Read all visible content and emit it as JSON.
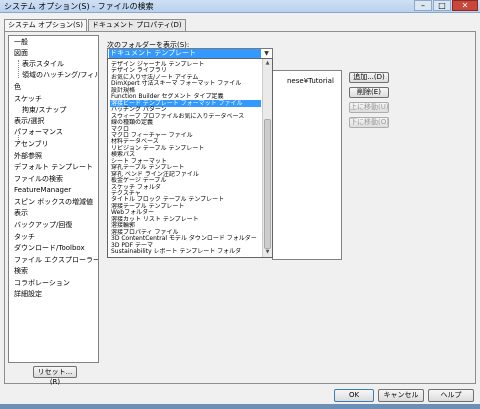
{
  "window": {
    "title": "システム オプション(S) - ファイルの検索"
  },
  "tabs": [
    {
      "label": "システム オプション(S)"
    },
    {
      "label": "ドキュメント プロパティ(D)"
    }
  ],
  "nav": {
    "items": [
      "一般",
      "図面",
      "表示スタイル",
      "領域のハッチング/フィル",
      "色",
      "スケッチ",
      "拘束/スナップ",
      "表示/選択",
      "パフォーマンス",
      "アセンブリ",
      "外部参照",
      "デフォルト テンプレート",
      "ファイルの検索",
      "FeatureManager",
      "スピン ボックスの増減値",
      "表示",
      "バックアップ/回復",
      "タッチ",
      "ダウンロード/Toolbox",
      "ファイル エクスプローラー",
      "検索",
      "コラボレーション",
      "詳細設定"
    ]
  },
  "reset_button": "リセット...(R)",
  "folder_label": "次のフォルダーを表示(S):",
  "combo": {
    "value": "ドキュメント テンプレート"
  },
  "background_list": {
    "text": "nese¥Tutorial"
  },
  "dropdown": {
    "items": [
      "デザイン ジャーナル テンプレート",
      "デザイン ライブラリ",
      "お気に入り寸法/ノート アイテム",
      "DimXpert 寸法スキーマ フォーマット ファイル",
      "設計規格",
      "Function Builder セグメント タイプ定義",
      "溶接ビード テンプレート フォーマット ファイル",
      "ハッチング パターン",
      "スウィープ プロファイルお気に入りデータベース",
      "線の種類の定義",
      "マクロ",
      "マクロ フィーチャー ファイル",
      "材料データベース",
      "リビジョン テーブル テンプレート",
      "検索パス",
      "シート フォーマット",
      "穿孔テーブル テンプレート",
      "穿孔 ベンド ライン注記ファイル",
      "板金ゲージ テーブル",
      "スケッチ フォルダ",
      "テクスチャ",
      "タイトル ブロック テーブル テンプレート",
      "溶接テーブル テンプレート",
      "Webフォルダー",
      "溶接カット リスト テンプレート",
      "溶接輪郭",
      "溶接プロパティ ファイル",
      "3D ContentCentral モデル ダウンロード フォルダー",
      "3D PDF テーマ",
      "Sustainability レポート テンプレート フォルダ"
    ],
    "selected_index": 6
  },
  "side_buttons": [
    {
      "label": "追加...(D)",
      "enabled": true
    },
    {
      "label": "削除(E)",
      "enabled": true
    },
    {
      "label": "上に移動(U)",
      "enabled": false
    },
    {
      "label": "下に移動(O)",
      "enabled": false
    }
  ],
  "footer": {
    "ok": "OK",
    "cancel": "キャンセル",
    "help": "ヘルプ"
  },
  "colors": {
    "selection": "#3399ff",
    "titlebar": "#b9d1ee",
    "close": "#c9473a"
  }
}
